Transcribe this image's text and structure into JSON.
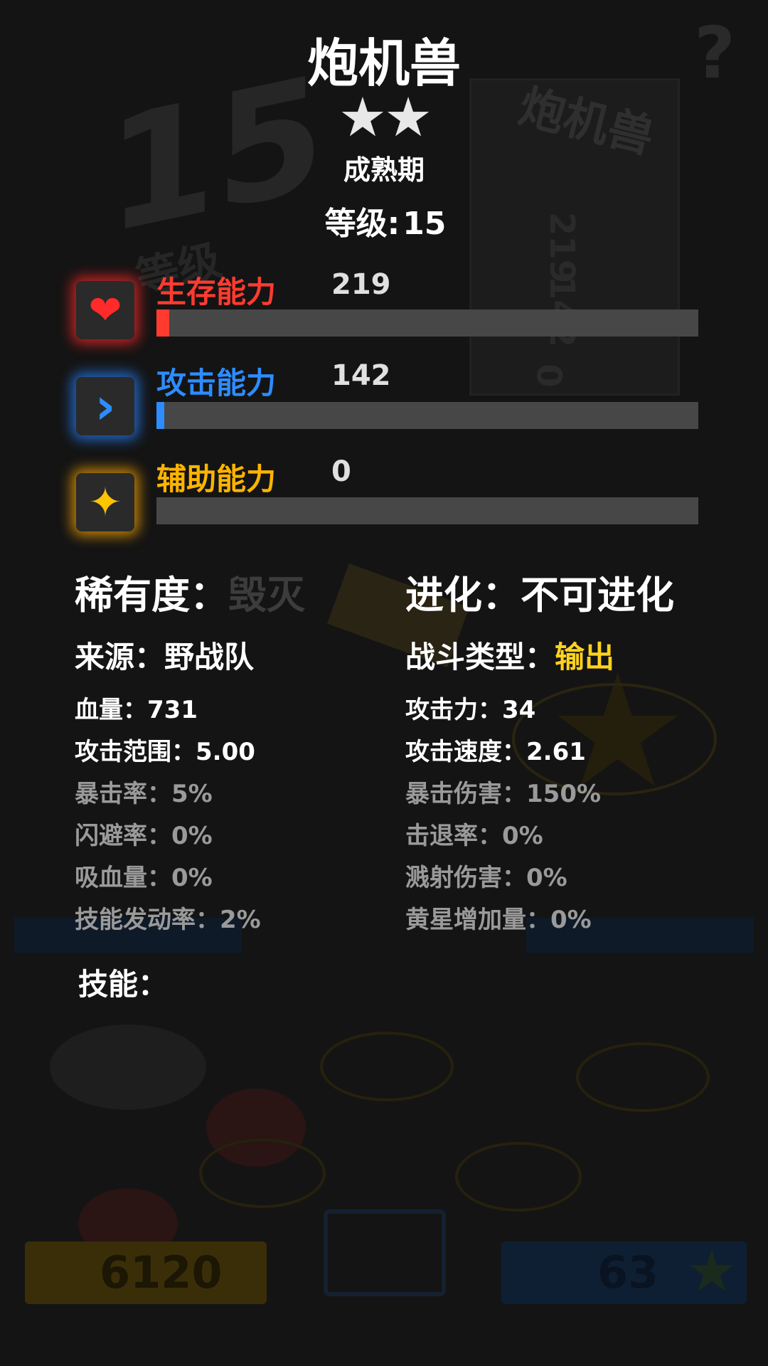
{
  "creature": {
    "name": "炮机兽",
    "stars": "★★",
    "stage": "成熟期",
    "level_label": "等级:",
    "level": "15"
  },
  "abilities": [
    {
      "name": "生存能力",
      "value": "219",
      "fraction": 0.023,
      "color": "#ff3b30",
      "icon": "heart-icon"
    },
    {
      "name": "攻击能力",
      "value": "142",
      "fraction": 0.015,
      "color": "#2d8cff",
      "icon": "chevron-right-icon"
    },
    {
      "name": "辅助能力",
      "value": "0",
      "fraction": 0,
      "color": "#ffb400",
      "icon": "sparkle-star-icon"
    }
  ],
  "rarity": {
    "label": "稀有度：",
    "value": "毁灭"
  },
  "evolution": {
    "label": "进化：",
    "value": "不可进化"
  },
  "source": {
    "label": "来源：",
    "value": "野战队"
  },
  "battle_type": {
    "label": "战斗类型：",
    "value": "输出"
  },
  "stats_left": [
    {
      "label": "血量：",
      "value": "731",
      "dim": false
    },
    {
      "label": "攻击范围：",
      "value": "5.00",
      "dim": false
    },
    {
      "label": "暴击率：",
      "value": "5%",
      "dim": true
    },
    {
      "label": "闪避率：",
      "value": "0%",
      "dim": true
    },
    {
      "label": "吸血量：",
      "value": "0%",
      "dim": true
    },
    {
      "label": "技能发动率：",
      "value": "2%",
      "dim": true
    }
  ],
  "stats_right": [
    {
      "label": "攻击力：",
      "value": "34",
      "dim": false
    },
    {
      "label": "攻击速度：",
      "value": "2.61",
      "dim": false
    },
    {
      "label": "暴击伤害：",
      "value": "150%",
      "dim": true
    },
    {
      "label": "击退率：",
      "value": "0%",
      "dim": true
    },
    {
      "label": "溅射伤害：",
      "value": "0%",
      "dim": true
    },
    {
      "label": "黄星增加量：",
      "value": "0%",
      "dim": true
    }
  ],
  "skills_label": "技能：",
  "background": {
    "coins": "6120",
    "stars_count": "63",
    "card_name": "炮机兽",
    "card_level": "15",
    "card_level_label": "等级",
    "card_values": [
      "219",
      "142",
      "0"
    ],
    "help_glyph": "?"
  }
}
